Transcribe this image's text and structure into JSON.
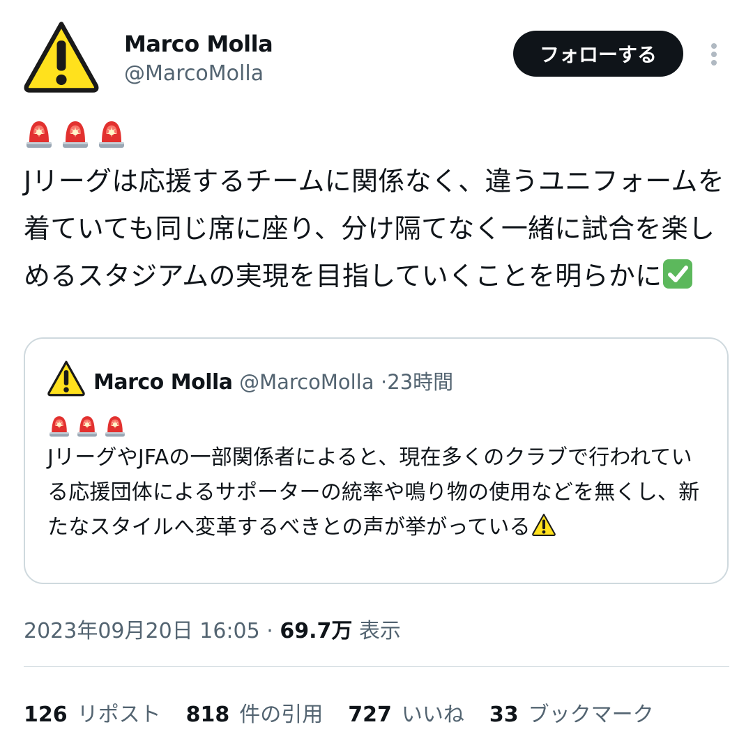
{
  "author": {
    "name": "Marco Molla",
    "handle": "@MarcoMolla",
    "avatar_icon": "warning-icon"
  },
  "follow_label": "フォローする",
  "more_icon": "more-vertical-icon",
  "tweet": {
    "emoji": [
      "police-light-icon",
      "police-light-icon",
      "police-light-icon"
    ],
    "text": "Jリーグは応援するチームに関係なく、違うユニフォームを着ていても同じ席に座り、分け隔てなく一緒に試合を楽しめるスタジアムの実現を目指していくことを明らかに",
    "trailing_emoji": "check-mark-icon"
  },
  "quote": {
    "name": "Marco Molla",
    "handle": "@MarcoMolla",
    "separator": "·",
    "time": "23時間",
    "emoji": [
      "police-light-icon",
      "police-light-icon",
      "police-light-icon"
    ],
    "text": "JリーグやJFAの一部関係者によると、現在多くのクラブで行われている応援団体によるサポーターの統率や鳴り物の使用などを無くし、新たなスタイルへ変革するべきとの声が挙がっている",
    "trailing_emoji": "warning-icon"
  },
  "meta": {
    "timestamp": "2023年09月20日 16:05",
    "separator": "·",
    "views_count": "69.7万",
    "views_label": "表示"
  },
  "stats": {
    "reposts": {
      "count": "126",
      "label": "リポスト"
    },
    "quotes": {
      "count": "818",
      "label": "件の引用"
    },
    "likes": {
      "count": "727",
      "label": "いいね"
    },
    "bookmarks": {
      "count": "33",
      "label": "ブックマーク"
    }
  },
  "colors": {
    "text": "#0f1419",
    "secondary": "#536471",
    "border": "#cfd9de",
    "warning_yellow": "#ffe11d",
    "siren_red": "#e2312f",
    "check_green": "#5cb85c"
  }
}
